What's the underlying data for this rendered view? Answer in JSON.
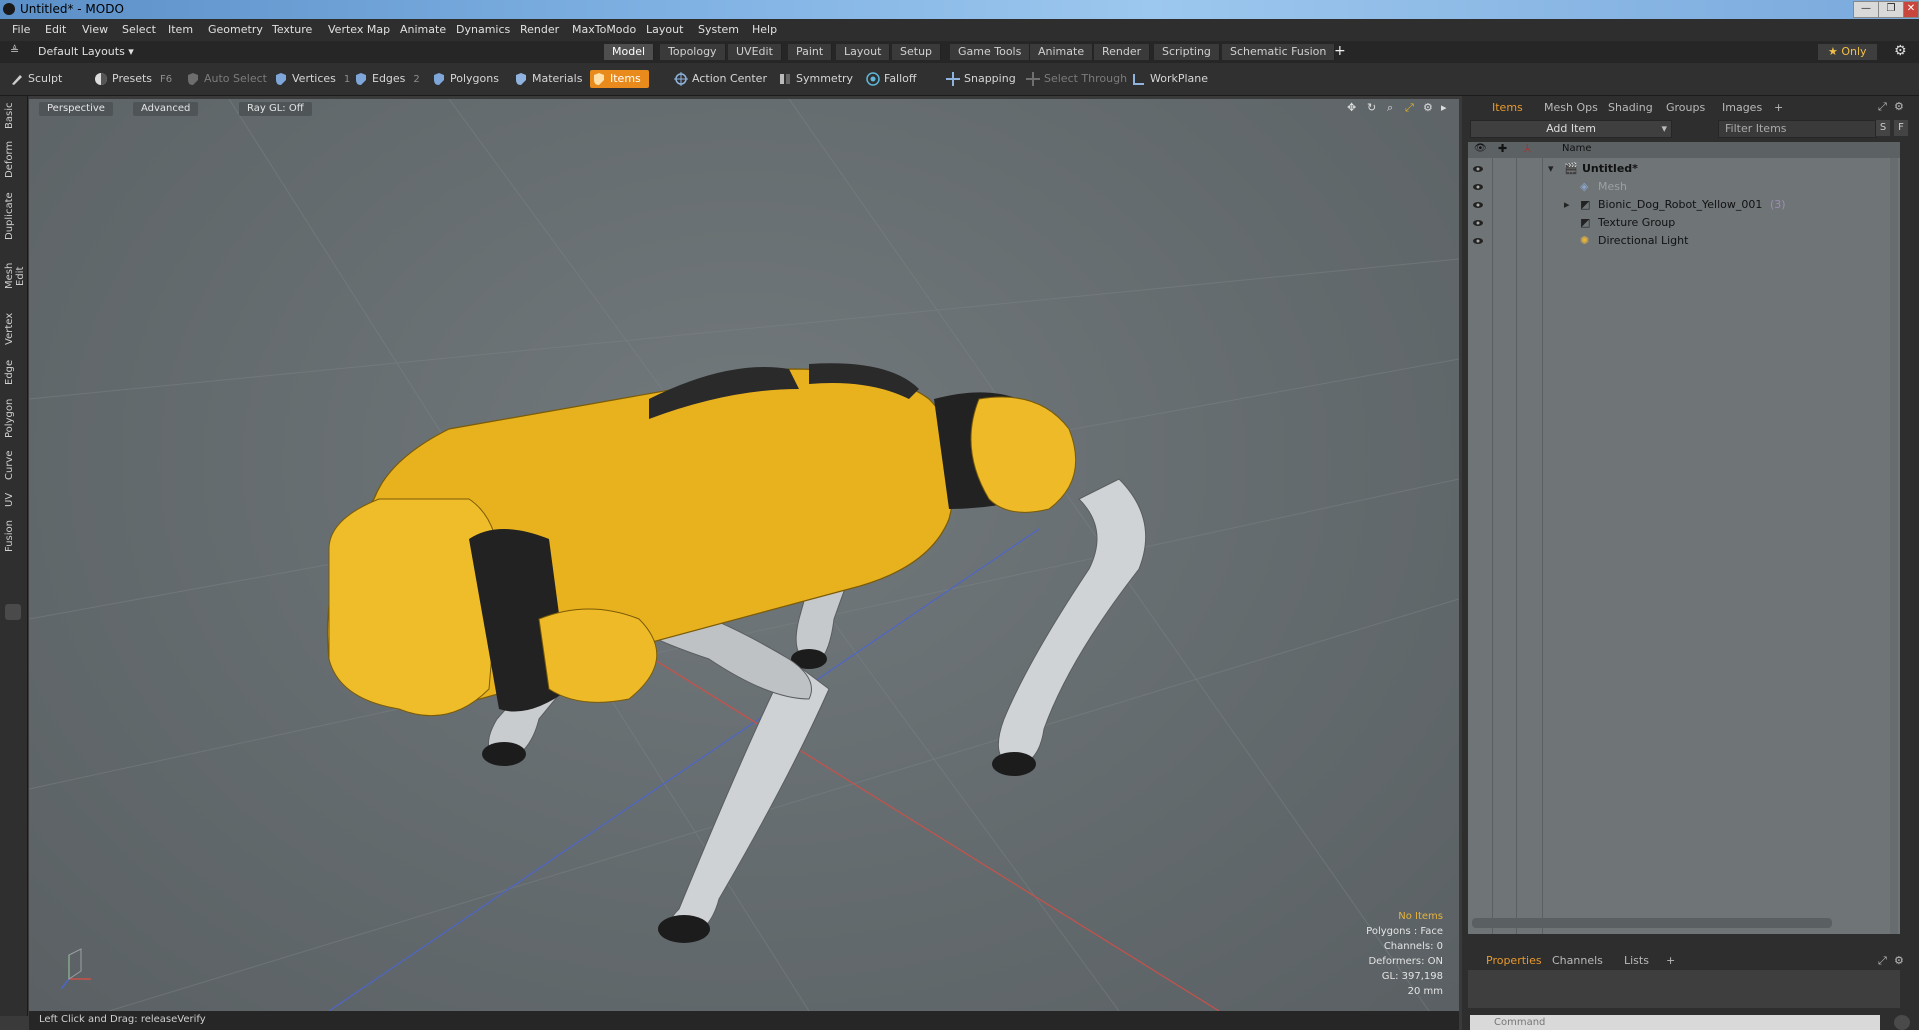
{
  "window": {
    "title": "Untitled* - MODO",
    "minimize_label": "—",
    "restore_label": "❐",
    "close_label": "✕"
  },
  "menubar": {
    "items": [
      "File",
      "Edit",
      "View",
      "Select",
      "Item",
      "Geometry",
      "Texture",
      "Vertex Map",
      "Animate",
      "Dynamics",
      "Render",
      "MaxToModo",
      "Layout",
      "System",
      "Help"
    ]
  },
  "layoutbar": {
    "layout_select": "Default Layouts ▾",
    "tabs": [
      "Model",
      "Topology",
      "UVEdit",
      "Paint",
      "Layout",
      "Setup",
      "Game Tools",
      "Animate",
      "Render",
      "Scripting",
      "Schematic Fusion"
    ],
    "active_tab": "Model",
    "add_tab": "+",
    "only_label": "★  Only",
    "gear_icon": "gear-icon"
  },
  "toolbar": {
    "sculpt": "Sculpt",
    "presets": "Presets",
    "presets_key": "F6",
    "auto_select": "Auto Select",
    "vertices": "Vertices",
    "vertices_key": "1",
    "edges": "Edges",
    "edges_key": "2",
    "polygons": "Polygons",
    "materials": "Materials",
    "items": "Items",
    "action_center": "Action Center",
    "symmetry": "Symmetry",
    "falloff": "Falloff",
    "snapping": "Snapping",
    "select_through": "Select Through",
    "workplane": "WorkPlane"
  },
  "lefttabs": [
    "Basic",
    "Deform",
    "Duplicate",
    "Mesh Edit",
    "Vertex",
    "Edge",
    "Polygon",
    "Curve",
    "UV",
    "Fusion"
  ],
  "viewport": {
    "view_mode": "Perspective",
    "shading": "Advanced",
    "raygl": "Ray GL: Off",
    "hud": {
      "selection": "No Items",
      "polygons": "Polygons : Face",
      "channels": "Channels: 0",
      "deformers": "Deformers: ON",
      "gl": "GL: 397,198",
      "unit": "20 mm"
    }
  },
  "statusbar": {
    "hint": "Left Click and Drag:  releaseVerify"
  },
  "rightpanel": {
    "tabs": [
      "Items",
      "Mesh Ops",
      "Shading",
      "Groups",
      "Images"
    ],
    "active_tab": "Items",
    "add_tab": "+",
    "add_item": "Add Item",
    "filter_placeholder": "Filter Items",
    "s_btn": "S",
    "f_btn": "F",
    "column_name": "Name",
    "tree": [
      {
        "label": "Untitled*",
        "bold": true,
        "indent": 0
      },
      {
        "label": "Mesh",
        "dim": true,
        "indent": 1
      },
      {
        "label": "Bionic_Dog_Robot_Yellow_001",
        "suffix": "(3)",
        "indent": 1
      },
      {
        "label": "Texture Group",
        "indent": 1
      },
      {
        "label": "Directional Light",
        "indent": 1
      }
    ],
    "bottom_tabs": [
      "Properties",
      "Channels",
      "Lists"
    ],
    "bottom_active": "Properties",
    "bottom_add": "+",
    "command_placeholder": "Command"
  },
  "colors": {
    "accent": "#e88a1c",
    "robot_yellow": "#e8b11e",
    "viewport_bg": "#666d70"
  }
}
